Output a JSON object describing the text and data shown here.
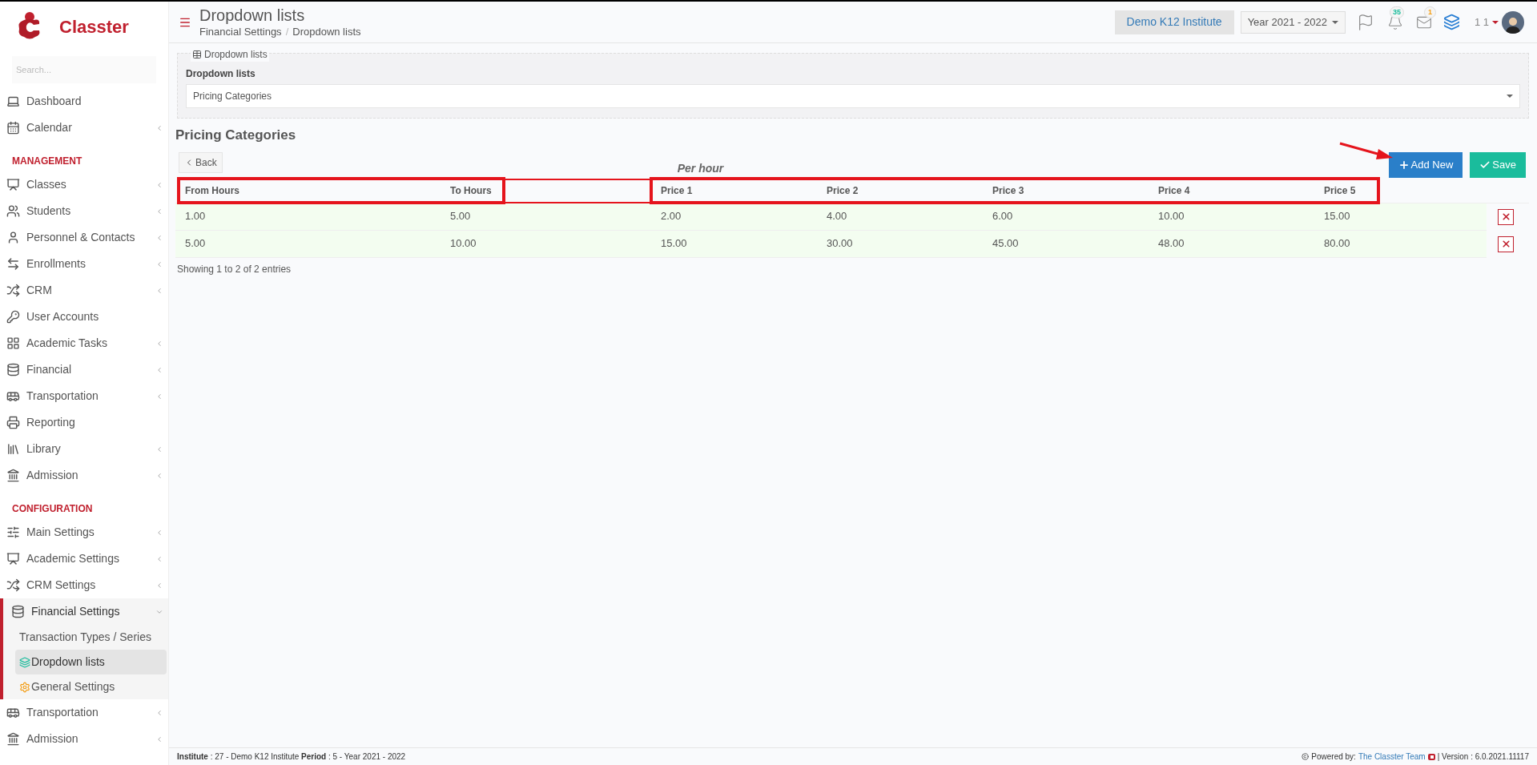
{
  "brand": {
    "name": "Classter"
  },
  "sidebar": {
    "search_placeholder": "Search...",
    "entries": [
      {
        "kind": "item",
        "label": "Dashboard",
        "expandable": false,
        "expanded": false
      },
      {
        "kind": "item",
        "label": "Calendar",
        "expandable": true,
        "expanded": false
      },
      {
        "kind": "heading",
        "label": "MANAGEMENT"
      },
      {
        "kind": "item",
        "label": "Classes",
        "expandable": true,
        "expanded": false
      },
      {
        "kind": "item",
        "label": "Students",
        "expandable": true,
        "expanded": false
      },
      {
        "kind": "item",
        "label": "Personnel & Contacts",
        "expandable": true,
        "expanded": false
      },
      {
        "kind": "item",
        "label": "Enrollments",
        "expandable": true,
        "expanded": false
      },
      {
        "kind": "item",
        "label": "CRM",
        "expandable": true,
        "expanded": false
      },
      {
        "kind": "item",
        "label": "User Accounts",
        "expandable": false,
        "expanded": false
      },
      {
        "kind": "item",
        "label": "Academic Tasks",
        "expandable": true,
        "expanded": false
      },
      {
        "kind": "item",
        "label": "Financial",
        "expandable": true,
        "expanded": false
      },
      {
        "kind": "item",
        "label": "Transportation",
        "expandable": true,
        "expanded": false
      },
      {
        "kind": "item",
        "label": "Reporting",
        "expandable": false,
        "expanded": false
      },
      {
        "kind": "item",
        "label": "Library",
        "expandable": true,
        "expanded": false
      },
      {
        "kind": "item",
        "label": "Admission",
        "expandable": true,
        "expanded": false
      },
      {
        "kind": "heading",
        "label": "CONFIGURATION"
      },
      {
        "kind": "item",
        "label": "Main Settings",
        "expandable": true,
        "expanded": false
      },
      {
        "kind": "item",
        "label": "Academic Settings",
        "expandable": true,
        "expanded": false
      },
      {
        "kind": "item",
        "label": "CRM Settings",
        "expandable": true,
        "expanded": false
      },
      {
        "kind": "item",
        "label": "Financial Settings",
        "expandable": true,
        "expanded": true,
        "children": [
          {
            "label": "Transaction Types / Series",
            "selected": false
          },
          {
            "label": "Dropdown lists",
            "selected": true
          },
          {
            "label": "General Settings",
            "selected": false
          }
        ]
      },
      {
        "kind": "item",
        "label": "Transportation",
        "expandable": true,
        "expanded": false
      },
      {
        "kind": "item",
        "label": "Admission",
        "expandable": true,
        "expanded": false
      }
    ]
  },
  "header": {
    "title": "Dropdown lists",
    "breadcrumbs": [
      "Financial Settings",
      "Dropdown lists"
    ],
    "breadcrumb_separator": "/",
    "institute": "Demo K12 Institute",
    "year": "Year 2021 - 2022",
    "notifications": "35",
    "messages": "1",
    "user": "1 1"
  },
  "filter": {
    "legend": "Dropdown lists",
    "label": "Dropdown lists",
    "value": "Pricing Categories"
  },
  "section_title": "Pricing Categories",
  "back_button": "Back",
  "group_label": "Per hour",
  "add_button": "Add New",
  "save_button": "Save",
  "table": {
    "columns": [
      "From Hours",
      "To Hours",
      "Price 1",
      "Price 2",
      "Price 3",
      "Price 4",
      "Price 5"
    ],
    "rows": [
      [
        "1.00",
        "5.00",
        "2.00",
        "4.00",
        "6.00",
        "10.00",
        "15.00"
      ],
      [
        "5.00",
        "10.00",
        "15.00",
        "30.00",
        "45.00",
        "48.00",
        "80.00"
      ]
    ]
  },
  "table_info": "Showing 1 to 2 of 2 entries",
  "footer": {
    "left": "**Institute** : 27 - Demo K12 Institute **Period** : 5 - Year 2021 - 2022",
    "powered": "Powered by:",
    "link": "The Classter Team",
    "version": "| Version : 6.0.2021.11117"
  }
}
